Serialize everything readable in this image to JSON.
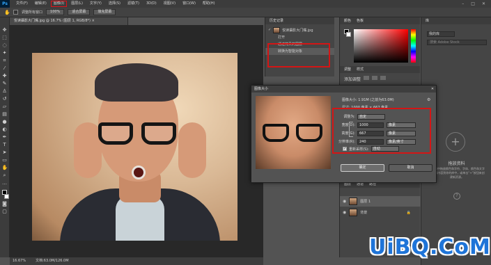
{
  "app": {
    "logo": "Ps"
  },
  "menu": [
    "文件(F)",
    "编辑(E)",
    "图像(I)",
    "图层(L)",
    "文字(Y)",
    "选择(S)",
    "滤镜(T)",
    "3D(D)",
    "视图(V)",
    "窗口(W)",
    "帮助(H)"
  ],
  "options": {
    "sample_label": "调整所有窗口",
    "zoom_value": "100%",
    "fit_label": "适合屏幕",
    "fill_label": "填充屏幕"
  },
  "document_tab": "悦读攝影大门嘴.jpg @ 16.7% (图层 1, RGB/8*) ×",
  "status": {
    "zoom": "16.67%",
    "doc": "文档:63.0M/126.0M"
  },
  "history": {
    "tab": "历史记录",
    "snapshot": "悦读攝影大门嘴.jpg",
    "items": [
      "打开",
      "通过拷贝的图层",
      "转换为智能对象"
    ]
  },
  "color_panel": {
    "tab": "颜色",
    "swatches_tab": "色板"
  },
  "adjustments": {
    "tab": "调整",
    "styles_tab": "样式",
    "subtitle": "添加调整"
  },
  "library": {
    "tab": "库",
    "select": "我的库",
    "search_placeholder": "搜索 Adobe Stock",
    "title": "拖放资料",
    "desc": "从文档中拖放颜色和字符、字体、颜色和文字资源等内容到你的库中，或单击“+”按钮来创建新资源。",
    "help_icon": "?"
  },
  "layers": {
    "tab": "图层",
    "channels_tab": "通道",
    "paths_tab": "路径",
    "layer1": "图层 1",
    "background": "背景"
  },
  "dialog": {
    "title": "图像大小",
    "image_size": "图像大小: 1.91M (之前为63.0M)",
    "dimensions": "尺寸: 1000 像素 × 667 像素",
    "fit_label": "调整为:",
    "fit_value": "自定",
    "width_label": "宽度(D):",
    "width_value": "1000",
    "width_unit": "像素",
    "height_label": "高度(G):",
    "height_value": "667",
    "height_unit": "像素",
    "res_label": "分辨率(R):",
    "res_value": "240",
    "res_unit": "像素/英寸",
    "resample_label": "重新采样(S):",
    "resample_value": "自动",
    "ok": "确定",
    "cancel": "取消"
  },
  "watermark": "UiBQ.CoM",
  "colors": {
    "highlight": "#d41515",
    "watermark": "#1e74d8"
  }
}
